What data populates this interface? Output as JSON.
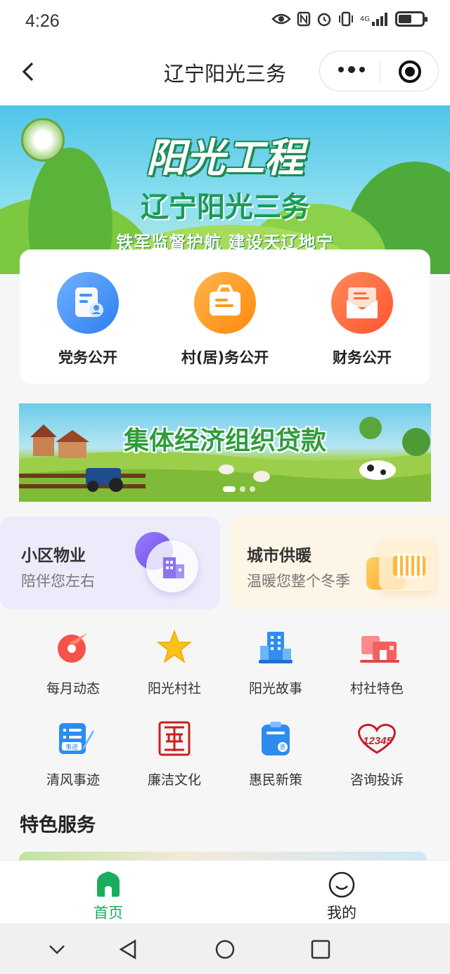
{
  "status": {
    "time": "4:26",
    "network": "4G",
    "battery_level": 0.55
  },
  "nav": {
    "title": "辽宁阳光三务"
  },
  "hero": {
    "title": "阳光工程",
    "subtitle": "辽宁阳光三务",
    "slogan": "铁军监督护航  建设天辽地宁"
  },
  "main_items": [
    {
      "label": "党务公开",
      "icon": "certificate-icon",
      "color": "#3c8ef5"
    },
    {
      "label": "村(居)务公开",
      "icon": "folder-icon",
      "color": "#ff9a1f"
    },
    {
      "label": "财务公开",
      "icon": "envelope-icon",
      "color": "#ff6a3d"
    }
  ],
  "banner2": {
    "text": "集体经济组织贷款"
  },
  "tiles": [
    {
      "title": "小区物业",
      "subtitle": "陪伴您左右",
      "icon": "building-icon"
    },
    {
      "title": "城市供暖",
      "subtitle": "温暖您整个冬季",
      "icon": "radiator-icon"
    }
  ],
  "grid": [
    {
      "label": "每月动态",
      "icon": "compass-icon"
    },
    {
      "label": "阳光村社",
      "icon": "star-icon"
    },
    {
      "label": "阳光故事",
      "icon": "tower-icon"
    },
    {
      "label": "村社特色",
      "icon": "house-icon"
    },
    {
      "label": "清风事迹",
      "icon": "notepad-icon",
      "badge": "事迹"
    },
    {
      "label": "廉洁文化",
      "icon": "seal-icon"
    },
    {
      "label": "惠民新策",
      "icon": "clipboard-icon",
      "badge": "惠"
    },
    {
      "label": "咨询投诉",
      "icon": "hotline-icon",
      "badge": "12345"
    }
  ],
  "section": {
    "title": "特色服务"
  },
  "tabs": [
    {
      "label": "首页",
      "icon": "home-icon",
      "active": true
    },
    {
      "label": "我的",
      "icon": "smile-icon",
      "active": false
    }
  ],
  "colors": {
    "accent": "#1aad5c",
    "tile1_bg": "#ecebfb",
    "tile2_bg": "#fdf5e6"
  }
}
